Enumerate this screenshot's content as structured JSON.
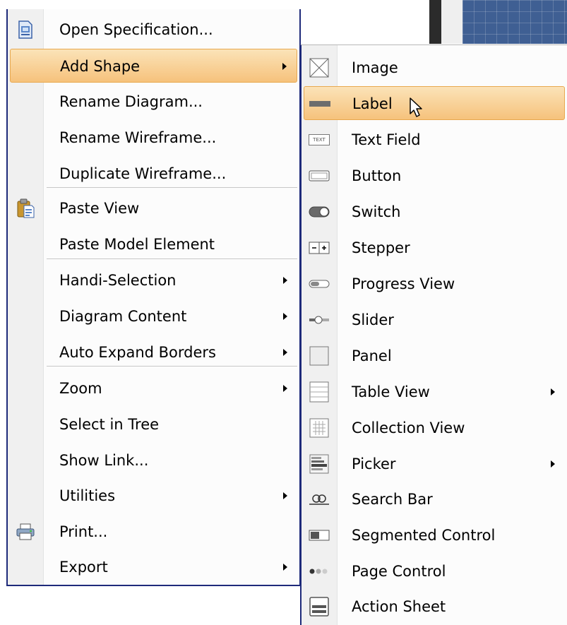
{
  "colors": {
    "highlight": "#f6c27c",
    "menu_border": "#1e2a7a",
    "canvas_grid": "#3f5f93"
  },
  "main_menu": {
    "items": [
      {
        "label": "Open Specification...",
        "icon": "open-specification-icon",
        "submenu": false
      },
      {
        "label": "Add Shape",
        "icon": "",
        "submenu": true,
        "highlighted": true
      },
      {
        "label": "Rename Diagram...",
        "icon": "",
        "submenu": false
      },
      {
        "label": "Rename Wireframe...",
        "icon": "",
        "submenu": false
      },
      {
        "label": "Duplicate Wireframe...",
        "icon": "",
        "submenu": false
      },
      {
        "label": "Paste View",
        "icon": "clipboard-paste-icon",
        "submenu": false
      },
      {
        "label": "Paste Model Element",
        "icon": "",
        "submenu": false
      },
      {
        "label": "Handi-Selection",
        "icon": "",
        "submenu": true
      },
      {
        "label": "Diagram Content",
        "icon": "",
        "submenu": true
      },
      {
        "label": "Auto Expand Borders",
        "icon": "",
        "submenu": true
      },
      {
        "label": "Zoom",
        "icon": "",
        "submenu": true
      },
      {
        "label": "Select in Tree",
        "icon": "",
        "submenu": false
      },
      {
        "label": "Show Link...",
        "icon": "",
        "submenu": false
      },
      {
        "label": "Utilities",
        "icon": "",
        "submenu": true
      },
      {
        "label": "Print...",
        "icon": "printer-icon",
        "submenu": false
      },
      {
        "label": "Export",
        "icon": "",
        "submenu": true
      }
    ]
  },
  "shape_submenu": {
    "items": [
      {
        "label": "Image",
        "icon": "image-placeholder-icon",
        "submenu": false
      },
      {
        "label": "Label",
        "icon": "label-shape-icon",
        "submenu": false,
        "highlighted": true
      },
      {
        "label": "Text Field",
        "icon": "text-field-icon",
        "submenu": false,
        "icon_text": "TEXT"
      },
      {
        "label": "Button",
        "icon": "button-shape-icon",
        "submenu": false
      },
      {
        "label": "Switch",
        "icon": "switch-shape-icon",
        "submenu": false
      },
      {
        "label": "Stepper",
        "icon": "stepper-shape-icon",
        "submenu": false
      },
      {
        "label": "Progress View",
        "icon": "progress-view-icon",
        "submenu": false
      },
      {
        "label": "Slider",
        "icon": "slider-shape-icon",
        "submenu": false
      },
      {
        "label": "Panel",
        "icon": "panel-shape-icon",
        "submenu": false
      },
      {
        "label": "Table View",
        "icon": "table-view-icon",
        "submenu": true
      },
      {
        "label": "Collection View",
        "icon": "collection-view-icon",
        "submenu": false
      },
      {
        "label": "Picker",
        "icon": "picker-shape-icon",
        "submenu": true
      },
      {
        "label": "Search Bar",
        "icon": "search-bar-icon",
        "submenu": false
      },
      {
        "label": "Segmented Control",
        "icon": "segmented-control-icon",
        "submenu": false
      },
      {
        "label": "Page Control",
        "icon": "page-control-icon",
        "submenu": false
      },
      {
        "label": "Action Sheet",
        "icon": "action-sheet-icon",
        "submenu": false
      }
    ]
  }
}
